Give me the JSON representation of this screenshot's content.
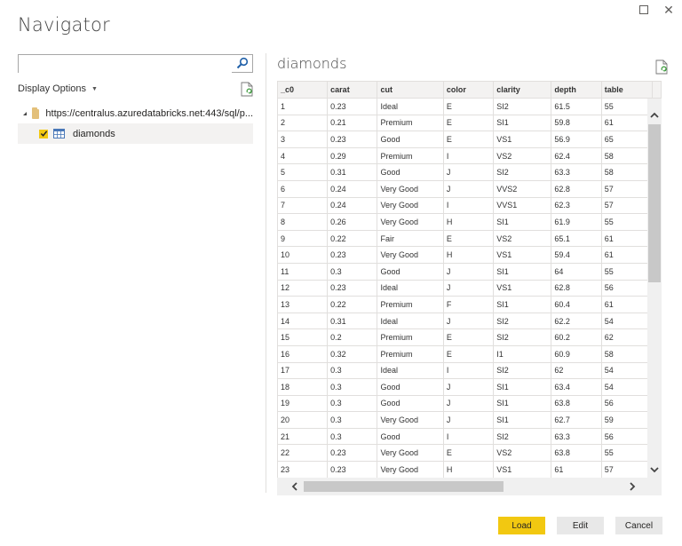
{
  "window": {
    "title": "Navigator",
    "maximize_label": "",
    "close_glyph": "✕"
  },
  "left": {
    "search": {
      "value": "",
      "placeholder": ""
    },
    "display_options_label": "Display Options",
    "display_options_caret": "▼",
    "tree": {
      "root": {
        "label": "https://centralus.azuredatabricks.net:443/sql/p...",
        "icon": "folder-icon",
        "expanded": true
      },
      "children": [
        {
          "label": "diamonds",
          "icon": "table-icon",
          "checked": true,
          "selected": true
        }
      ]
    }
  },
  "preview": {
    "title": "diamonds",
    "columns": [
      "_c0",
      "carat",
      "cut",
      "color",
      "clarity",
      "depth",
      "table"
    ],
    "rows": [
      [
        "1",
        "0.23",
        "Ideal",
        "E",
        "SI2",
        "61.5",
        "55"
      ],
      [
        "2",
        "0.21",
        "Premium",
        "E",
        "SI1",
        "59.8",
        "61"
      ],
      [
        "3",
        "0.23",
        "Good",
        "E",
        "VS1",
        "56.9",
        "65"
      ],
      [
        "4",
        "0.29",
        "Premium",
        "I",
        "VS2",
        "62.4",
        "58"
      ],
      [
        "5",
        "0.31",
        "Good",
        "J",
        "SI2",
        "63.3",
        "58"
      ],
      [
        "6",
        "0.24",
        "Very Good",
        "J",
        "VVS2",
        "62.8",
        "57"
      ],
      [
        "7",
        "0.24",
        "Very Good",
        "I",
        "VVS1",
        "62.3",
        "57"
      ],
      [
        "8",
        "0.26",
        "Very Good",
        "H",
        "SI1",
        "61.9",
        "55"
      ],
      [
        "9",
        "0.22",
        "Fair",
        "E",
        "VS2",
        "65.1",
        "61"
      ],
      [
        "10",
        "0.23",
        "Very Good",
        "H",
        "VS1",
        "59.4",
        "61"
      ],
      [
        "11",
        "0.3",
        "Good",
        "J",
        "SI1",
        "64",
        "55"
      ],
      [
        "12",
        "0.23",
        "Ideal",
        "J",
        "VS1",
        "62.8",
        "56"
      ],
      [
        "13",
        "0.22",
        "Premium",
        "F",
        "SI1",
        "60.4",
        "61"
      ],
      [
        "14",
        "0.31",
        "Ideal",
        "J",
        "SI2",
        "62.2",
        "54"
      ],
      [
        "15",
        "0.2",
        "Premium",
        "E",
        "SI2",
        "60.2",
        "62"
      ],
      [
        "16",
        "0.32",
        "Premium",
        "E",
        "I1",
        "60.9",
        "58"
      ],
      [
        "17",
        "0.3",
        "Ideal",
        "I",
        "SI2",
        "62",
        "54"
      ],
      [
        "18",
        "0.3",
        "Good",
        "J",
        "SI1",
        "63.4",
        "54"
      ],
      [
        "19",
        "0.3",
        "Good",
        "J",
        "SI1",
        "63.8",
        "56"
      ],
      [
        "20",
        "0.3",
        "Very Good",
        "J",
        "SI1",
        "62.7",
        "59"
      ],
      [
        "21",
        "0.3",
        "Good",
        "I",
        "SI2",
        "63.3",
        "56"
      ],
      [
        "22",
        "0.23",
        "Very Good",
        "E",
        "VS2",
        "63.8",
        "55"
      ],
      [
        "23",
        "0.23",
        "Very Good",
        "H",
        "VS1",
        "61",
        "57"
      ],
      [
        "",
        "",
        "",
        "",
        "",
        "",
        ""
      ]
    ],
    "scroll": {
      "up_glyph": "^",
      "down_glyph": "v",
      "left_glyph": "<",
      "right_glyph": ">"
    }
  },
  "footer": {
    "load_label": "Load",
    "edit_label": "Edit",
    "cancel_label": "Cancel"
  },
  "colors": {
    "accent": "#f2c811",
    "secondary_button": "#e8e8e8",
    "selected_row": "#f3f2f1",
    "folder": "#e3c07a"
  }
}
